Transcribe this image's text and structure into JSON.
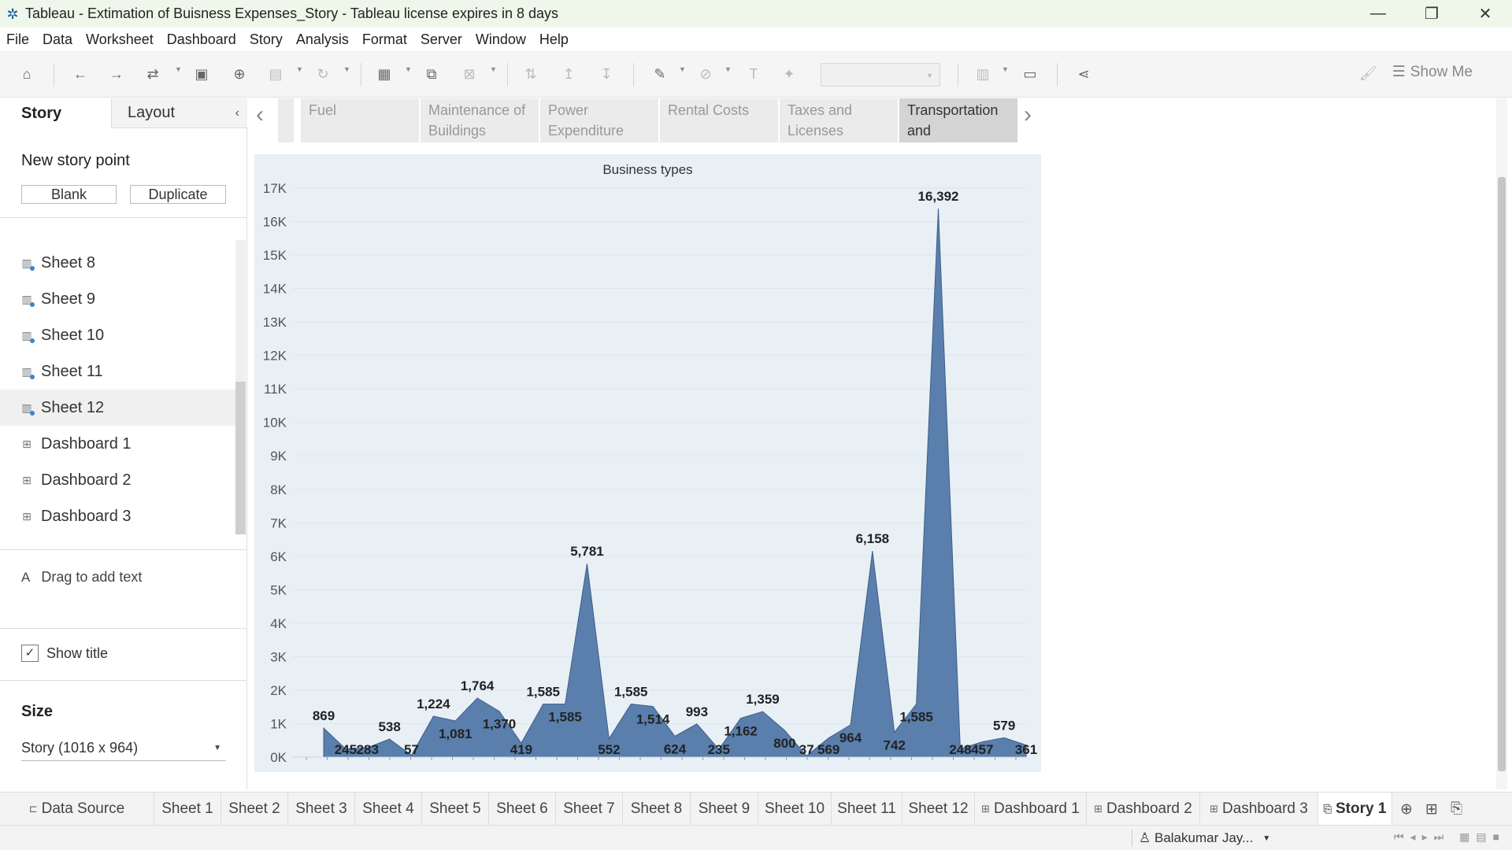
{
  "window": {
    "title": "Tableau - Extimation of Buisness Expenses_Story - Tableau license expires in 8 days",
    "app_icon": "tableau-icon"
  },
  "menu": [
    "File",
    "Data",
    "Worksheet",
    "Dashboard",
    "Story",
    "Analysis",
    "Format",
    "Server",
    "Window",
    "Help"
  ],
  "toolbar": {
    "show_me_label": "Show Me"
  },
  "left_panel": {
    "tabs": [
      "Story",
      "Layout"
    ],
    "new_story_point": "New story point",
    "blank_button": "Blank",
    "duplicate_button": "Duplicate",
    "sheets": [
      {
        "label": "Sheet 8",
        "type": "sheet"
      },
      {
        "label": "Sheet 9",
        "type": "sheet"
      },
      {
        "label": "Sheet 10",
        "type": "sheet"
      },
      {
        "label": "Sheet 11",
        "type": "sheet"
      },
      {
        "label": "Sheet 12",
        "type": "sheet",
        "selected": true
      },
      {
        "label": "Dashboard 1",
        "type": "dashboard"
      },
      {
        "label": "Dashboard 2",
        "type": "dashboard"
      },
      {
        "label": "Dashboard 3",
        "type": "dashboard"
      }
    ],
    "drag_text_icon": "A",
    "drag_text": "Drag to add text",
    "show_title": "Show title",
    "size_label": "Size",
    "size_value": "Story (1016 x 964)"
  },
  "story_points": [
    {
      "label": "Fuel",
      "active": false
    },
    {
      "label": "Maintenance of Buildings",
      "active": false
    },
    {
      "label": "Power Expenditure",
      "active": false
    },
    {
      "label": "Rental Costs",
      "active": false
    },
    {
      "label": "Taxes and Licenses",
      "active": false
    },
    {
      "label": "Transportation and",
      "active": true
    }
  ],
  "chart_data": {
    "type": "area",
    "title": "Business types",
    "ylim": [
      0,
      17000
    ],
    "yticks": [
      "0K",
      "1K",
      "2K",
      "3K",
      "4K",
      "5K",
      "6K",
      "7K",
      "8K",
      "9K",
      "10K",
      "11K",
      "12K",
      "13K",
      "14K",
      "15K",
      "16K",
      "17K"
    ],
    "fill_color": "#5a7fac",
    "background_color": "#e8f0f6",
    "series": [
      {
        "values": [
          869,
          245,
          283,
          538,
          57,
          1224,
          1081,
          1764,
          1370,
          419,
          1585,
          1585,
          5781,
          552,
          1585,
          1514,
          624,
          993,
          235,
          1162,
          1359,
          800,
          37,
          569,
          964,
          6158,
          742,
          1585,
          16392,
          248,
          457,
          579,
          361
        ]
      }
    ],
    "data_labels": [
      "869",
      "245",
      "283",
      "538",
      "57",
      "1,224",
      "1,081",
      "1,764",
      "1,370",
      "419",
      "1,585",
      "1,585",
      "5,781",
      "552",
      "1,585",
      "1,514",
      "624",
      "993",
      "235",
      "1,162",
      "1,359",
      "800",
      "37",
      "569",
      "964",
      "6,158",
      "742",
      "1,585",
      "16,392",
      "248",
      "457",
      "579",
      "361"
    ]
  },
  "bottom_tabs": [
    "Data Source",
    "Sheet 1",
    "Sheet 2",
    "Sheet 3",
    "Sheet 4",
    "Sheet 5",
    "Sheet 6",
    "Sheet 7",
    "Sheet 8",
    "Sheet 9",
    "Sheet 10",
    "Sheet 11",
    "Sheet 12",
    "Dashboard 1",
    "Dashboard 2",
    "Dashboard 3",
    "Story 1"
  ],
  "status": {
    "user": "Balakumar Jay..."
  }
}
